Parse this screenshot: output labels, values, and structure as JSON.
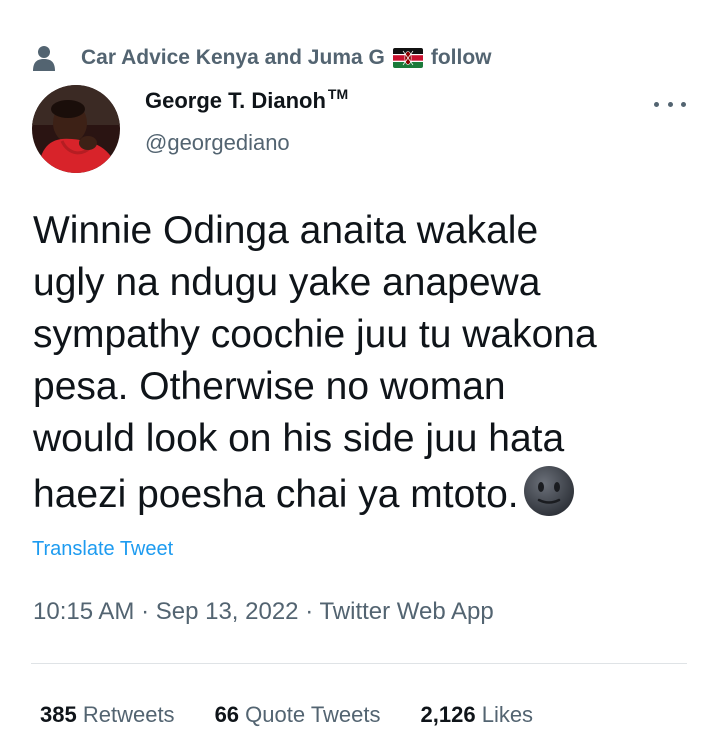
{
  "social_context": {
    "icon": "person-icon",
    "text_before_flag": "Car Advice Kenya and Juma G",
    "flag_icon": "kenya-flag-icon",
    "text_after_flag": "follow"
  },
  "author": {
    "display_name": "George T. Dianoh",
    "name_suffix": "TM",
    "handle": "@georgediano"
  },
  "tweet": {
    "lines": [
      "Winnie Odinga anaita wakale",
      "ugly na ndugu yake anapewa",
      "sympathy coochie juu tu wakona",
      "pesa. Otherwise no woman",
      "would look on his side juu hata",
      "haezi poesha chai ya mtoto."
    ],
    "emoji": "neutral-face-icon"
  },
  "translate_label": "Translate Tweet",
  "meta": {
    "time": "10:15 AM",
    "sep1": " · ",
    "date": "Sep 13, 2022",
    "sep2": " · ",
    "app": "Twitter Web App"
  },
  "stats": {
    "retweets_count": "385",
    "retweets_label": "Retweets",
    "quotes_count": "66",
    "quotes_label": "Quote Tweets",
    "likes_count": "2,126",
    "likes_label": "Likes"
  },
  "colors": {
    "text": "#0f1419",
    "secondary": "#536471",
    "link": "#1d9bf0"
  }
}
